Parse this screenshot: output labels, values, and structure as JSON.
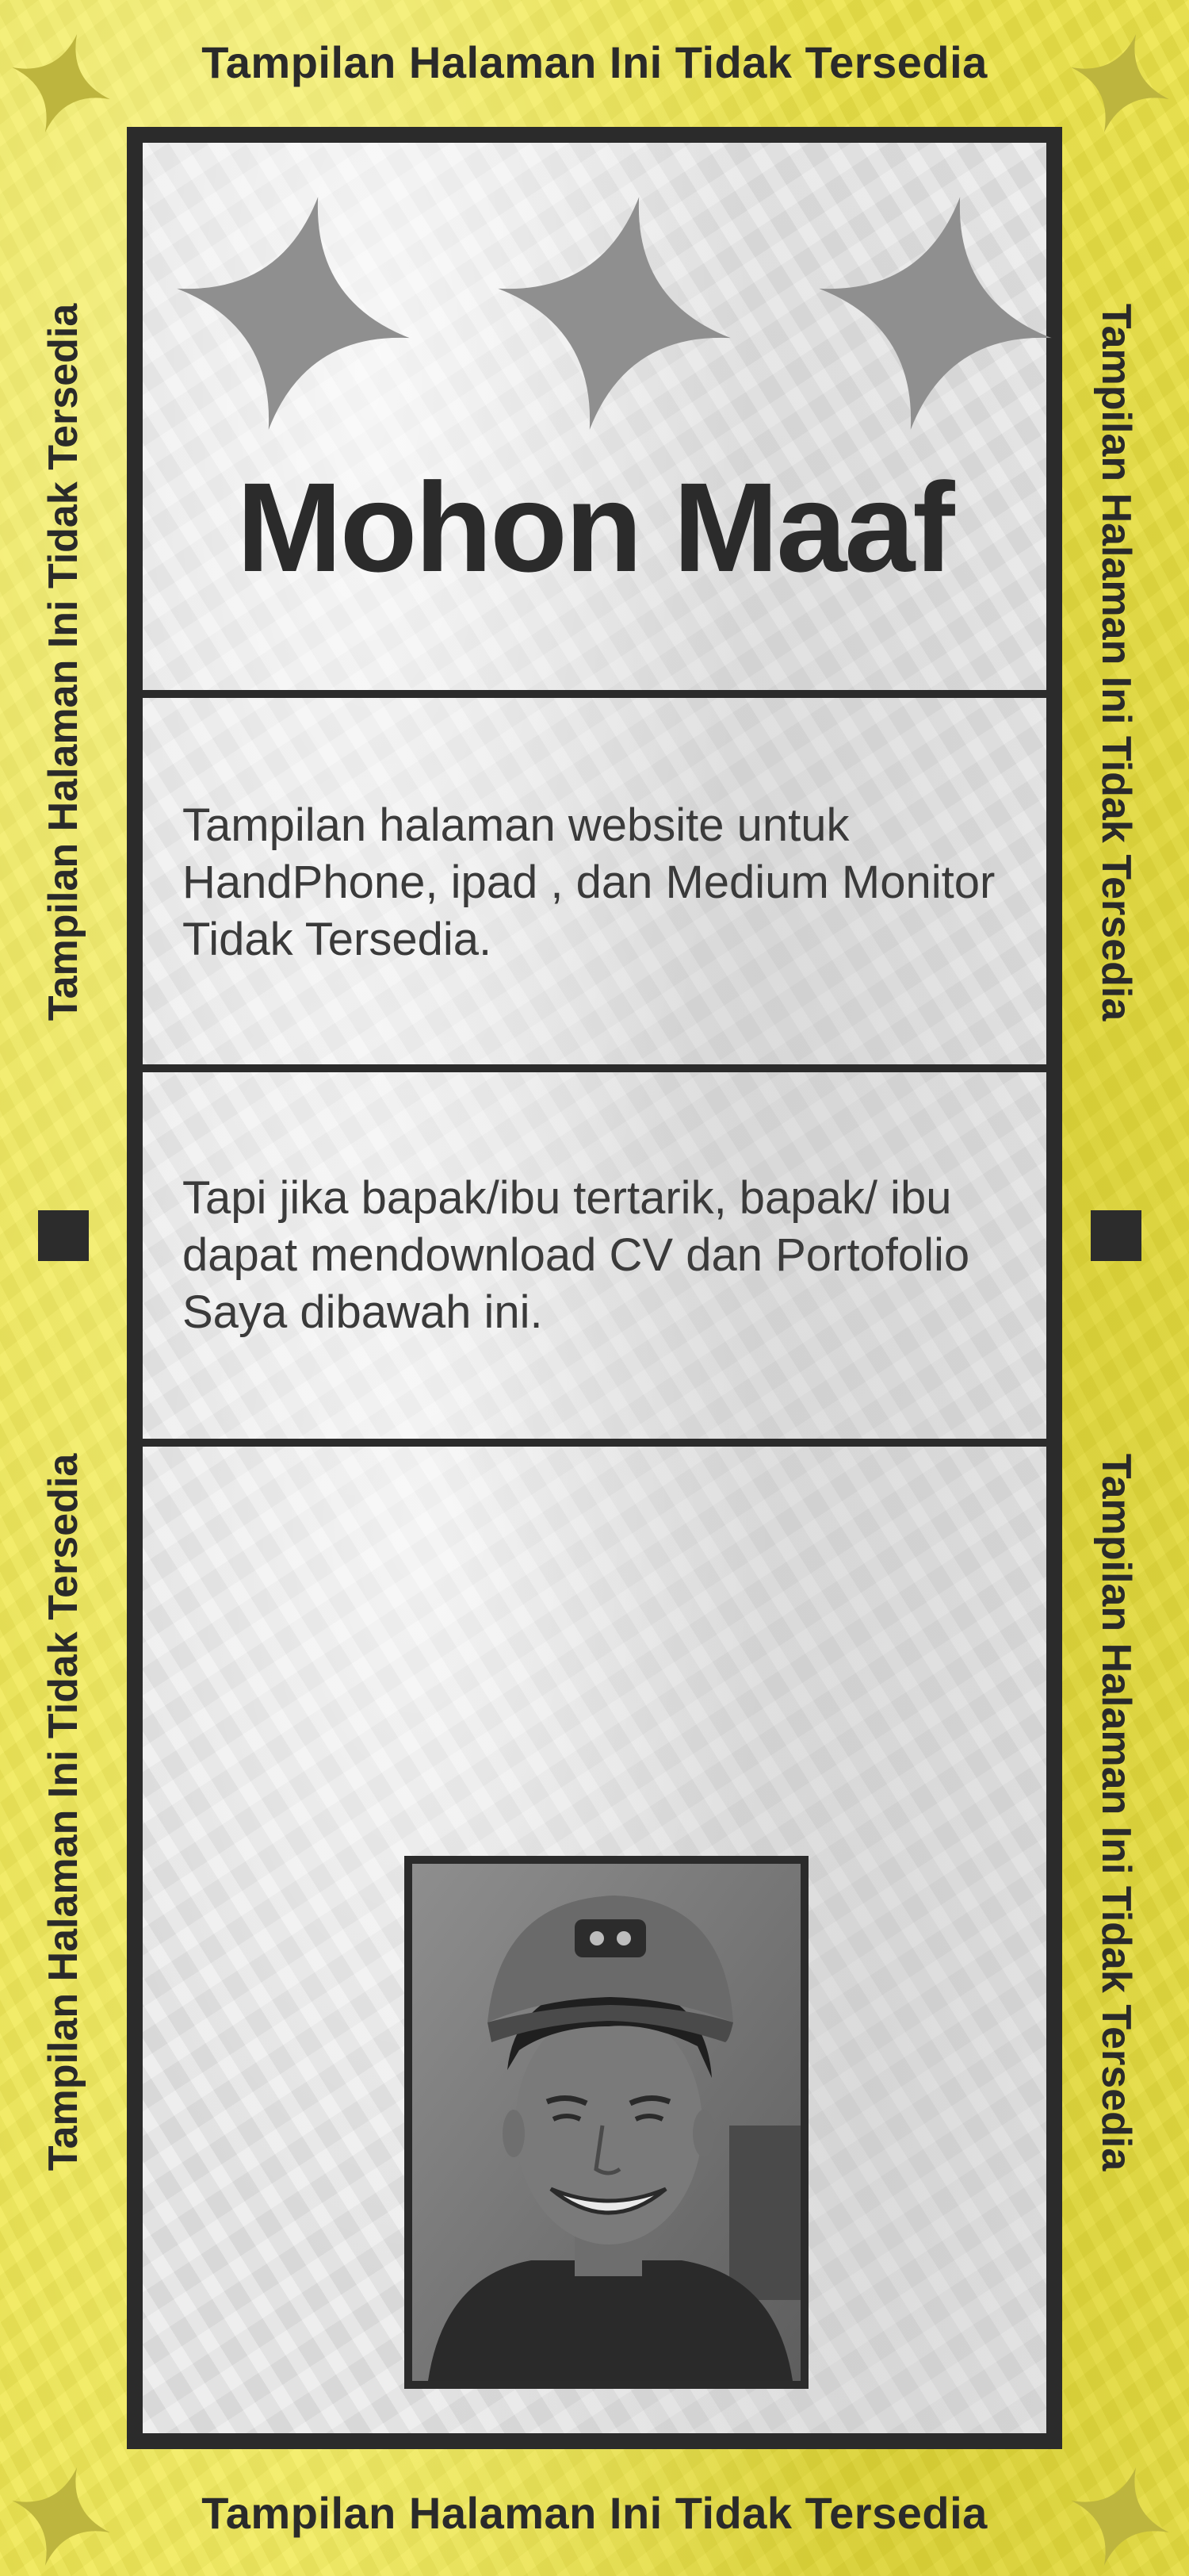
{
  "banner": {
    "top_text": "Tampilan Halaman Ini Tidak Tersedia",
    "bottom_text": "Tampilan Halaman Ini Tidak Tersedia"
  },
  "side_texts": {
    "left_upper": "Tampilan Halaman Ini Tidak Tersedia",
    "left_lower": "Tampilan Halaman Ini Tidak Tersedia",
    "right_upper": "Tampilan Halaman Ini Tidak Tersedia",
    "right_lower": "Tampilan Halaman Ini Tidak Tersedia"
  },
  "card": {
    "title": "Mohon Maaf",
    "paragraph_1": "Tampilan halaman website untuk HandPhone, ipad , dan Medium Monitor Tidak Tersedia.",
    "paragraph_2": "Tapi jika bapak/ibu tertarik, bapak/ ibu dapat mendownload CV dan Portofolio Saya dibawah ini.",
    "decor_icons": [
      "four-point-star-icon",
      "four-point-star-icon",
      "four-point-star-icon"
    ],
    "photo_icon": "profile-photo"
  },
  "colors": {
    "background_yellow": "#eee64a",
    "ink": "#2b2b2b",
    "paper": "#e7e7e7",
    "star_gray": "#8f8f8f",
    "corner_star": "#bdb53e"
  }
}
